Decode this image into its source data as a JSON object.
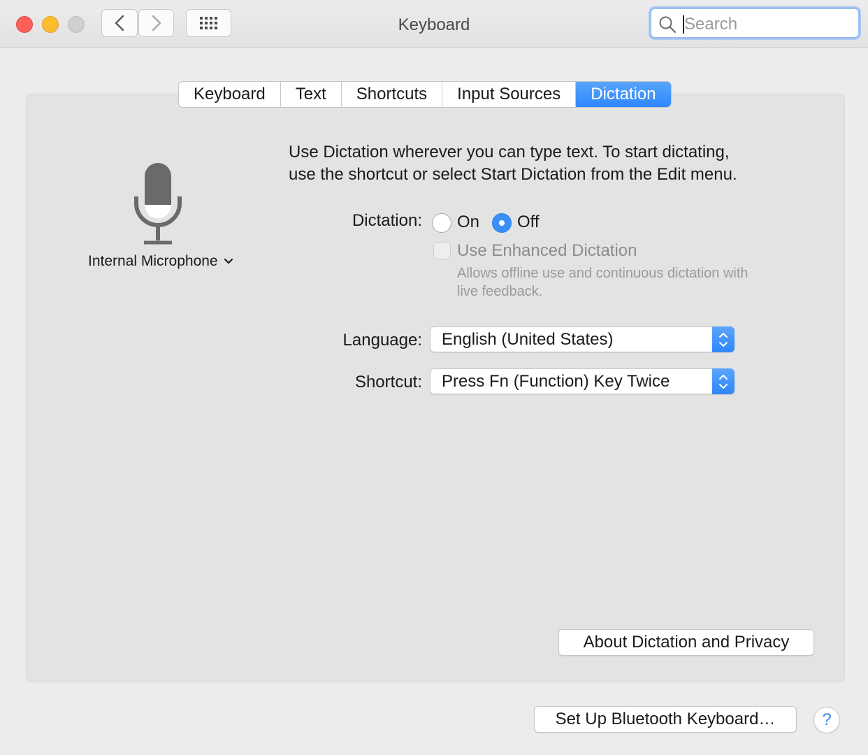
{
  "window": {
    "title": "Keyboard",
    "search_placeholder": "Search"
  },
  "tabs": [
    {
      "label": "Keyboard",
      "active": false
    },
    {
      "label": "Text",
      "active": false
    },
    {
      "label": "Shortcuts",
      "active": false
    },
    {
      "label": "Input Sources",
      "active": false
    },
    {
      "label": "Dictation",
      "active": true
    }
  ],
  "microphone": {
    "source_label": "Internal Microphone"
  },
  "dictation": {
    "intro_line1": "Use Dictation wherever you can type text. To start dictating,",
    "intro_line2": "use the shortcut or select Start Dictation from the Edit menu.",
    "label": "Dictation:",
    "option_on": "On",
    "option_off": "Off",
    "selected": "Off",
    "enhanced_label": "Use Enhanced Dictation",
    "enhanced_checked": false,
    "enhanced_desc_line1": "Allows offline use and continuous dictation with",
    "enhanced_desc_line2": "live feedback."
  },
  "language": {
    "label": "Language:",
    "value": "English (United States)"
  },
  "shortcut": {
    "label": "Shortcut:",
    "value": "Press Fn (Function) Key Twice"
  },
  "buttons": {
    "about": "About Dictation and Privacy",
    "bluetooth": "Set Up Bluetooth Keyboard…",
    "help": "?"
  },
  "colors": {
    "accent": "#2f86fb",
    "close": "#fc5f57",
    "minimize": "#fdbc2e",
    "zoom_disabled": "#d0d0d0"
  }
}
